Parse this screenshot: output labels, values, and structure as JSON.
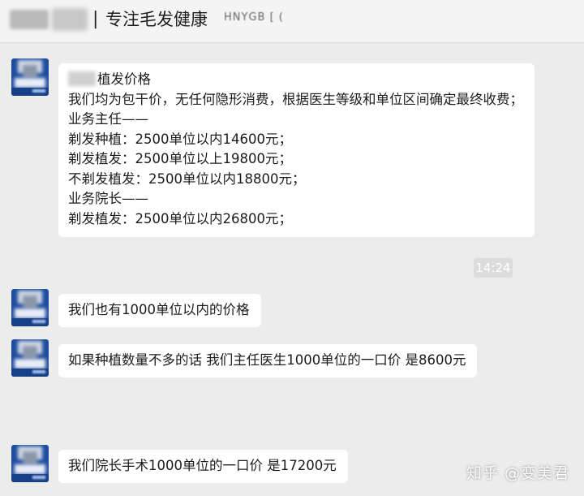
{
  "header": {
    "separator": "|",
    "title": "专注毛发健康",
    "suffix": "HNYGB [ ("
  },
  "messages": [
    {
      "lines": [
        "植发价格",
        "我们均为包干价，无任何隐形消费，根据医生等级和单位区间确定最终收费；",
        "业务主任——",
        "剃发种植：2500单位以内14600元；",
        "剃发植发：2500单位以上19800元；",
        "不剃发植发：2500单位以内18800元；",
        "业务院长——",
        "剃发植发：2500单位以内26800元；"
      ]
    },
    {
      "text": "我们也有1000单位以内的价格"
    },
    {
      "text": "如果种植数量不多的话 我们主任医生1000单位的一口价 是8600元"
    },
    {
      "text": "我们院长手术1000单位的一口价 是17200元"
    }
  ],
  "timestamp": "14:24",
  "watermark": "知乎 @变美君"
}
